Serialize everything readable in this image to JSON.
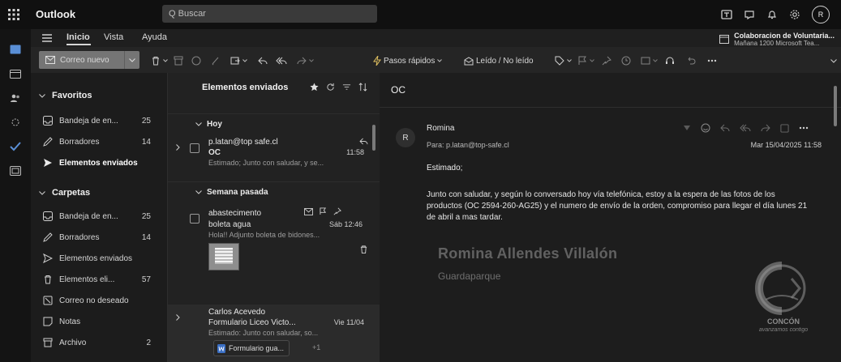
{
  "topbar": {
    "app_title": "Outlook",
    "search_placeholder": "Q Buscar"
  },
  "ribbon": {
    "tabs": [
      "Inicio",
      "Vista",
      "Ayuda"
    ],
    "reminder_title": "Colaboracion de Voluntaria...",
    "reminder_subtitle": "Mañana 1200 Microsoft Tea..."
  },
  "toolbar": {
    "new_mail": "Correo nuevo",
    "quick_steps": "Pasos rápidos",
    "read_unread": "Leído / No leído"
  },
  "folders": {
    "favorites_label": "Favoritos",
    "favorites": [
      {
        "icon": "inbox-icon",
        "label": "Bandeja de en...",
        "count": "25"
      },
      {
        "icon": "drafts-icon",
        "label": "Borradores",
        "count": "14"
      },
      {
        "icon": "send-icon",
        "label": "Elementos enviados",
        "count": ""
      }
    ],
    "folders_label": "Carpetas",
    "items": [
      {
        "icon": "inbox-icon",
        "label": "Bandeja de en...",
        "count": "25"
      },
      {
        "icon": "drafts-icon",
        "label": "Borradores",
        "count": "14"
      },
      {
        "icon": "send-icon",
        "label": "Elementos enviados",
        "count": ""
      },
      {
        "icon": "trash-icon",
        "label": "Elementos eli...",
        "count": "57"
      },
      {
        "icon": "junk-icon",
        "label": "Correo no deseado",
        "count": ""
      },
      {
        "icon": "notes-icon",
        "label": "Notas",
        "count": ""
      },
      {
        "icon": "archive-icon",
        "label": "Archivo",
        "count": "2"
      }
    ]
  },
  "list": {
    "title": "Elementos enviados",
    "groups": [
      "Hoy",
      "Semana pasada"
    ],
    "messages": [
      {
        "from": "p.latan@top safe.cl",
        "subject": "OC",
        "time": "11:58",
        "preview": "Estimado; Junto con saludar, y se..."
      },
      {
        "from": "abastecimento",
        "subject": "boleta agua",
        "time": "Sáb 12:46",
        "preview": "Hola!! Adjunto boleta de bidones..."
      },
      {
        "from": "Carlos Acevedo",
        "subject": "Formulario Liceo Victo...",
        "time": "Vie 11/04",
        "preview": "Estimado: Junto con saludar, so...",
        "attachment": "Formulario gua...",
        "attachment_more": "+1"
      }
    ]
  },
  "reading": {
    "subject": "OC",
    "sender_initial": "R",
    "sender_name": "Romina",
    "to": "Para: p.latan@top-safe.cl",
    "date": "Mar 15/04/2025 11:58",
    "greeting": "Estimado;",
    "body": "Junto con saludar, y según lo conversado hoy vía telefónica, estoy a la espera de las fotos de los productos (OC 2594-260-AG25) y el numero de envío de la orden, compromiso para llegar el día lunes 21 de abril a mas tardar.",
    "signature_name": "Romina Allendes Villalón",
    "signature_role": "Guardaparque",
    "logo_text": "CONCÓN",
    "logo_tagline": "avanzamos contigo"
  },
  "user": {
    "initial": "R"
  }
}
